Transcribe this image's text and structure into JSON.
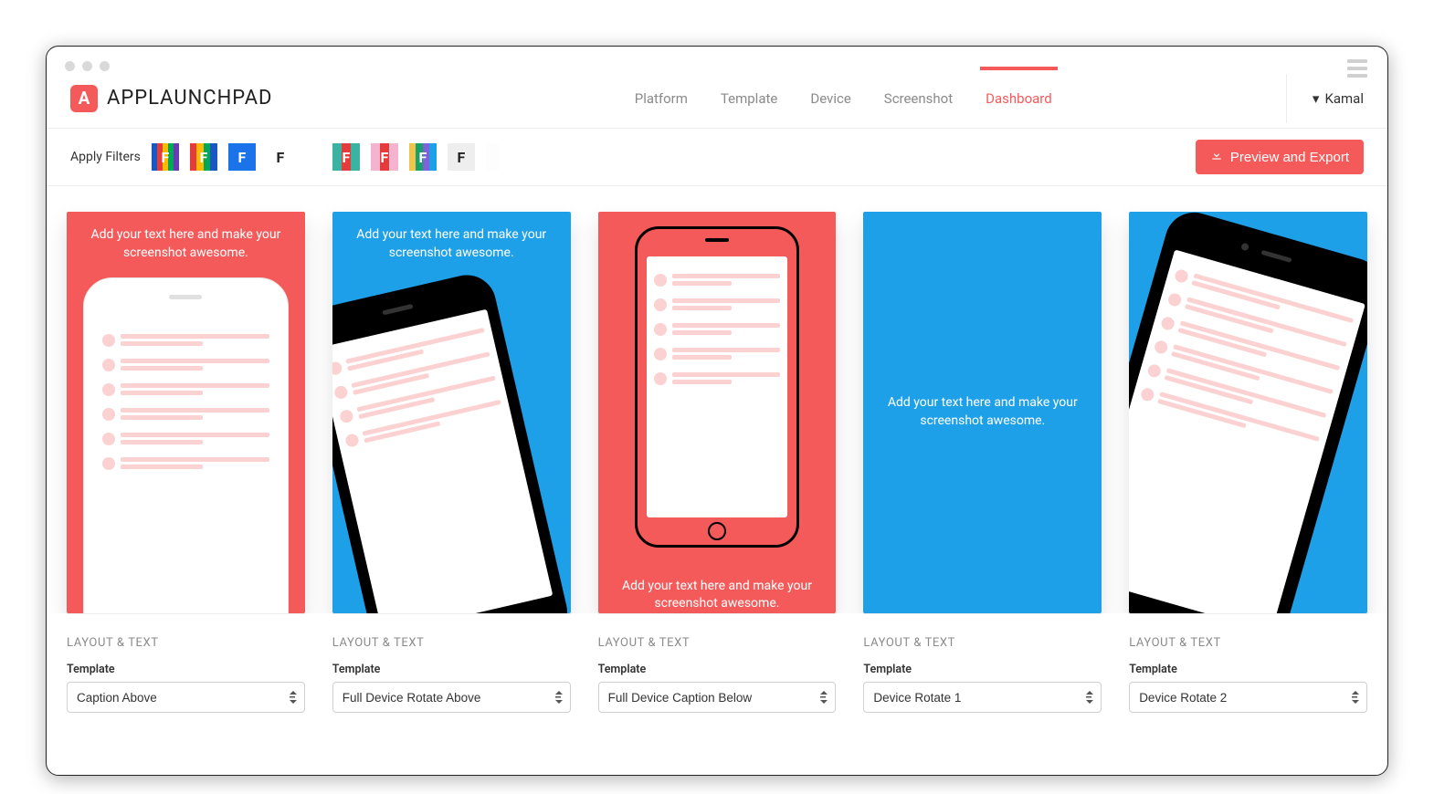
{
  "brand": "APPLAUNCHPAD",
  "nav": {
    "platform": "Platform",
    "template": "Template",
    "device": "Device",
    "screenshot": "Screenshot",
    "dashboard": "Dashboard"
  },
  "user": {
    "name": "Kamal"
  },
  "filters": {
    "label": "Apply Filters",
    "items": [
      {
        "colors": [
          "#1957c1",
          "#e43b3b",
          "#ffba00",
          "#00a85a",
          "#6a3ab2"
        ]
      },
      {
        "colors": [
          "#e43b3b",
          "#ffba00",
          "#00a85a",
          "#1957c1"
        ]
      },
      {
        "colors": [
          "#1a73e8",
          "#1a73e8"
        ]
      },
      {
        "colors": [
          "#ffffff"
        ],
        "dark": true
      },
      {
        "colors": [
          "#3bb3a3",
          "#e43b3b",
          "#3bb3a3"
        ]
      },
      {
        "colors": [
          "#f6b3d0",
          "#e43b3b",
          "#f6b3d0"
        ]
      },
      {
        "colors": [
          "#efc64b",
          "#1aa06b",
          "#7d62d9",
          "#1ea0e8"
        ]
      },
      {
        "colors": [
          "#eeeeee"
        ],
        "dark": true
      },
      {
        "colors": [
          "#fdfdfd"
        ],
        "dark": true,
        "half": true
      }
    ]
  },
  "export_label": "Preview and Export",
  "screens": [
    {
      "bg": "red",
      "caption_pos": "top",
      "caption": "Add your text here and make your screenshot awesome."
    },
    {
      "bg": "blue",
      "caption_pos": "top",
      "caption": "Add your text here and make your screenshot awesome."
    },
    {
      "bg": "red",
      "caption_pos": "bottom",
      "caption": "Add your text here and make your screenshot awesome."
    },
    {
      "bg": "blue",
      "caption_pos": "middle",
      "caption": "Add your text here and make your screenshot awesome."
    },
    {
      "bg": "blue",
      "caption_pos": "none",
      "caption": ""
    }
  ],
  "section": {
    "heading": "LAYOUT & TEXT",
    "field_label": "Template",
    "values": [
      "Caption Above",
      "Full Device Rotate Above",
      "Full Device Caption Below",
      "Device Rotate 1",
      "Device Rotate 2"
    ]
  }
}
